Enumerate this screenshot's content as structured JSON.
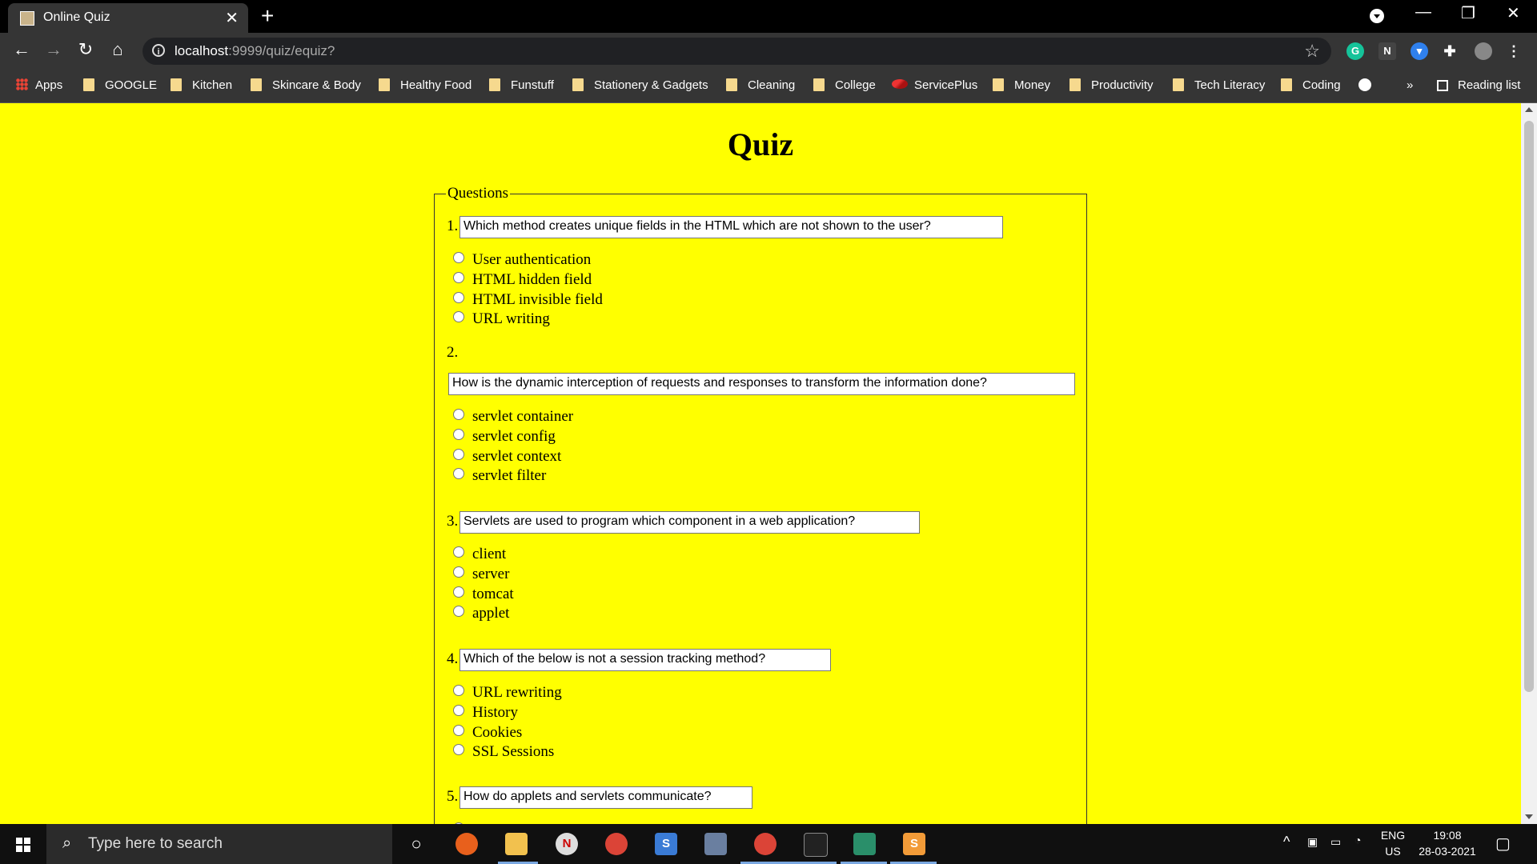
{
  "browser": {
    "tab_title": "Online Quiz",
    "url_host": "localhost",
    "url_rest": ":9999/quiz/equiz?",
    "bookmarks": [
      "Apps",
      "GOOGLE",
      "Kitchen",
      "Skincare & Body",
      "Healthy Food",
      "Funstuff",
      "Stationery & Gadgets",
      "Cleaning",
      "College",
      "ServicePlus",
      "Money",
      "Productivity",
      "Tech Literacy",
      "Coding"
    ],
    "reading_list": "Reading list",
    "overflow": "»"
  },
  "page": {
    "title": "Quiz",
    "legend": "Questions",
    "questions": [
      {
        "num": "1.",
        "text": "Which method creates unique fields in the HTML which are not shown to the user?",
        "options": [
          "User authentication",
          "HTML hidden field",
          "HTML invisible field",
          "URL writing"
        ]
      },
      {
        "num": "2.",
        "text": "How is the dynamic interception of requests and responses to transform the information done?",
        "options": [
          "servlet container",
          "servlet config",
          "servlet context",
          "servlet filter"
        ]
      },
      {
        "num": "3.",
        "text": "Servlets are used to program which component in a web application?",
        "options": [
          "client",
          "server",
          "tomcat",
          "applet"
        ]
      },
      {
        "num": "4.",
        "text": "Which of the below is not a session tracking method?",
        "options": [
          "URL rewriting",
          "History",
          "Cookies",
          "SSL Sessions"
        ]
      },
      {
        "num": "5.",
        "text": "How do applets and servlets communicate?",
        "options": []
      }
    ]
  },
  "taskbar": {
    "search_placeholder": "Type here to search",
    "lang": "ENG",
    "region": "US",
    "time": "19:08",
    "date": "28-03-2021"
  },
  "colors": {
    "page_bg": "#ffff00",
    "browser_chrome": "#353535"
  }
}
